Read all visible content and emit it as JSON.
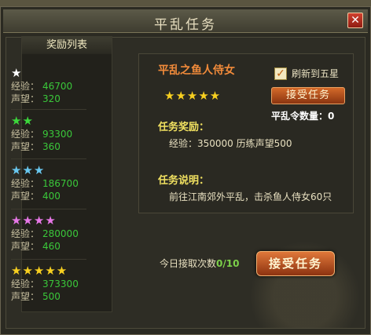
{
  "title": "平乱任务",
  "close_icon": "close-icon",
  "reward_list": {
    "header": "奖励列表",
    "exp_label": "经验：",
    "rep_label": "声望：",
    "tiers": [
      {
        "stars": "★",
        "exp": "46700",
        "rep": "320",
        "color": "#ffffff"
      },
      {
        "stars": "★★",
        "exp": "93300",
        "rep": "360",
        "color": "#3cd83c"
      },
      {
        "stars": "★★★",
        "exp": "186700",
        "rep": "400",
        "color": "#69c8f0"
      },
      {
        "stars": "★★★★",
        "exp": "280000",
        "rep": "460",
        "color": "#e878e8"
      },
      {
        "stars": "★★★★★",
        "exp": "373300",
        "rep": "500",
        "color": "#f8d020"
      }
    ]
  },
  "task": {
    "name": "平乱之鱼人侍女",
    "stars": "★★★★★",
    "refresh_label": "刷新到五星",
    "refresh_checked": true,
    "accept_label": "接受任务",
    "token_label": "平乱令数量：",
    "token_count": "0",
    "reward_title": "任务奖励：",
    "reward_text": "经验：350000  历练声望500",
    "desc_title": "任务说明：",
    "desc_text": "前往江南郊外平乱，击杀鱼人侍女60只"
  },
  "footer": {
    "today_label": "今日接取次数",
    "today_count": "0/10",
    "accept_label": "接受任务"
  }
}
